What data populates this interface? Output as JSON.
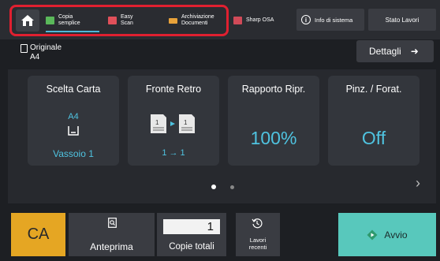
{
  "topbar": {
    "tabs": [
      {
        "label_line1": "Copia",
        "label_line2": "semplice"
      },
      {
        "label_line1": "Easy",
        "label_line2": "Scan"
      },
      {
        "label_line1": "Archiviazione",
        "label_line2": "Documenti"
      },
      {
        "label_line1": "Sharp OSA",
        "label_line2": ""
      }
    ],
    "info_label": "Info di sistema",
    "stato_label": "Stato Lavori",
    "highlight_color": "#e02030"
  },
  "original": {
    "label": "Originale",
    "value": "A4"
  },
  "details_label": "Dettagli",
  "cards": {
    "paper": {
      "title": "Scelta Carta",
      "size": "A4",
      "tray": "Vassoio 1"
    },
    "duplex": {
      "title": "Fronte Retro",
      "value": "1 → 1"
    },
    "ratio": {
      "title": "Rapporto Ripr.",
      "value": "100%"
    },
    "staple": {
      "title": "Pinz. / Forat.",
      "value": "Off"
    }
  },
  "bottom": {
    "ca_label": "CA",
    "preview_label": "Anteprima",
    "copies_value": "1",
    "copies_label": "Copie totali",
    "recent_line1": "Lavori",
    "recent_line2": "recenti",
    "start_label": "Avvio"
  },
  "colors": {
    "accent": "#4fc3e0",
    "ca": "#e5a623",
    "start": "#58c8bc"
  },
  "icons": [
    "home-icon",
    "copy-icon",
    "easy-scan-icon",
    "folder-icon",
    "sharp-osa-icon",
    "info-icon",
    "original-doc-icon",
    "arrow-right-icon",
    "tray-icon",
    "duplex-icon",
    "chevron-right-icon",
    "preview-icon",
    "recent-jobs-icon",
    "start-icon"
  ]
}
